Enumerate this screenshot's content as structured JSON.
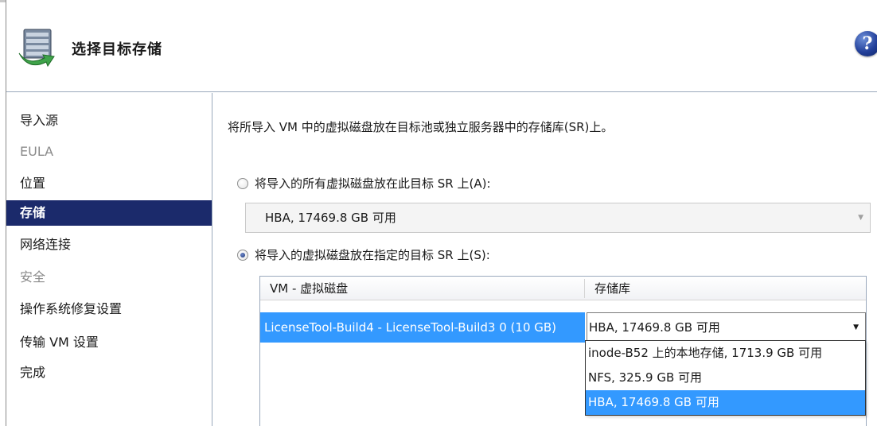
{
  "header": {
    "title": "选择目标存储",
    "icon": "import-storage-icon",
    "help_symbol": "?"
  },
  "sidebar": {
    "items": [
      {
        "label": "导入源",
        "state": "normal"
      },
      {
        "label": "EULA",
        "state": "disabled"
      },
      {
        "label": "位置",
        "state": "normal"
      },
      {
        "label": "存储",
        "state": "active"
      },
      {
        "label": "网络连接",
        "state": "normal"
      },
      {
        "label": "安全",
        "state": "disabled"
      },
      {
        "label": "操作系统修复设置",
        "state": "normal"
      },
      {
        "label": "传输 VM 设置",
        "state": "normal"
      },
      {
        "label": "完成",
        "state": "normal"
      }
    ]
  },
  "main": {
    "description": "将所导入 VM 中的虚拟磁盘放在目标池或独立服务器中的存储库(SR)上。",
    "option_all": {
      "label": "将导入的所有虚拟磁盘放在此目标 SR 上(A):",
      "checked": false
    },
    "all_sr_value": "HBA, 17469.8 GB 可用",
    "option_specific": {
      "label": "将导入的虚拟磁盘放在指定的目标 SR 上(S):",
      "checked": true
    },
    "table": {
      "columns": [
        "VM - 虚拟磁盘",
        "存储库"
      ],
      "rows": [
        {
          "vm_disk": "LicenseTool-Build4 - LicenseTool-Build3 0 (10 GB)",
          "sr": "HBA, 17469.8 GB 可用"
        }
      ]
    },
    "sr_dropdown": {
      "options": [
        "inode-B52 上的本地存储, 1713.9 GB 可用",
        "NFS, 325.9 GB 可用",
        "HBA, 17469.8 GB 可用"
      ],
      "selected_index": 2
    }
  },
  "colors": {
    "accent_active": "#1b2a6b",
    "selection": "#3399ff",
    "border": "#9aa9bc"
  }
}
